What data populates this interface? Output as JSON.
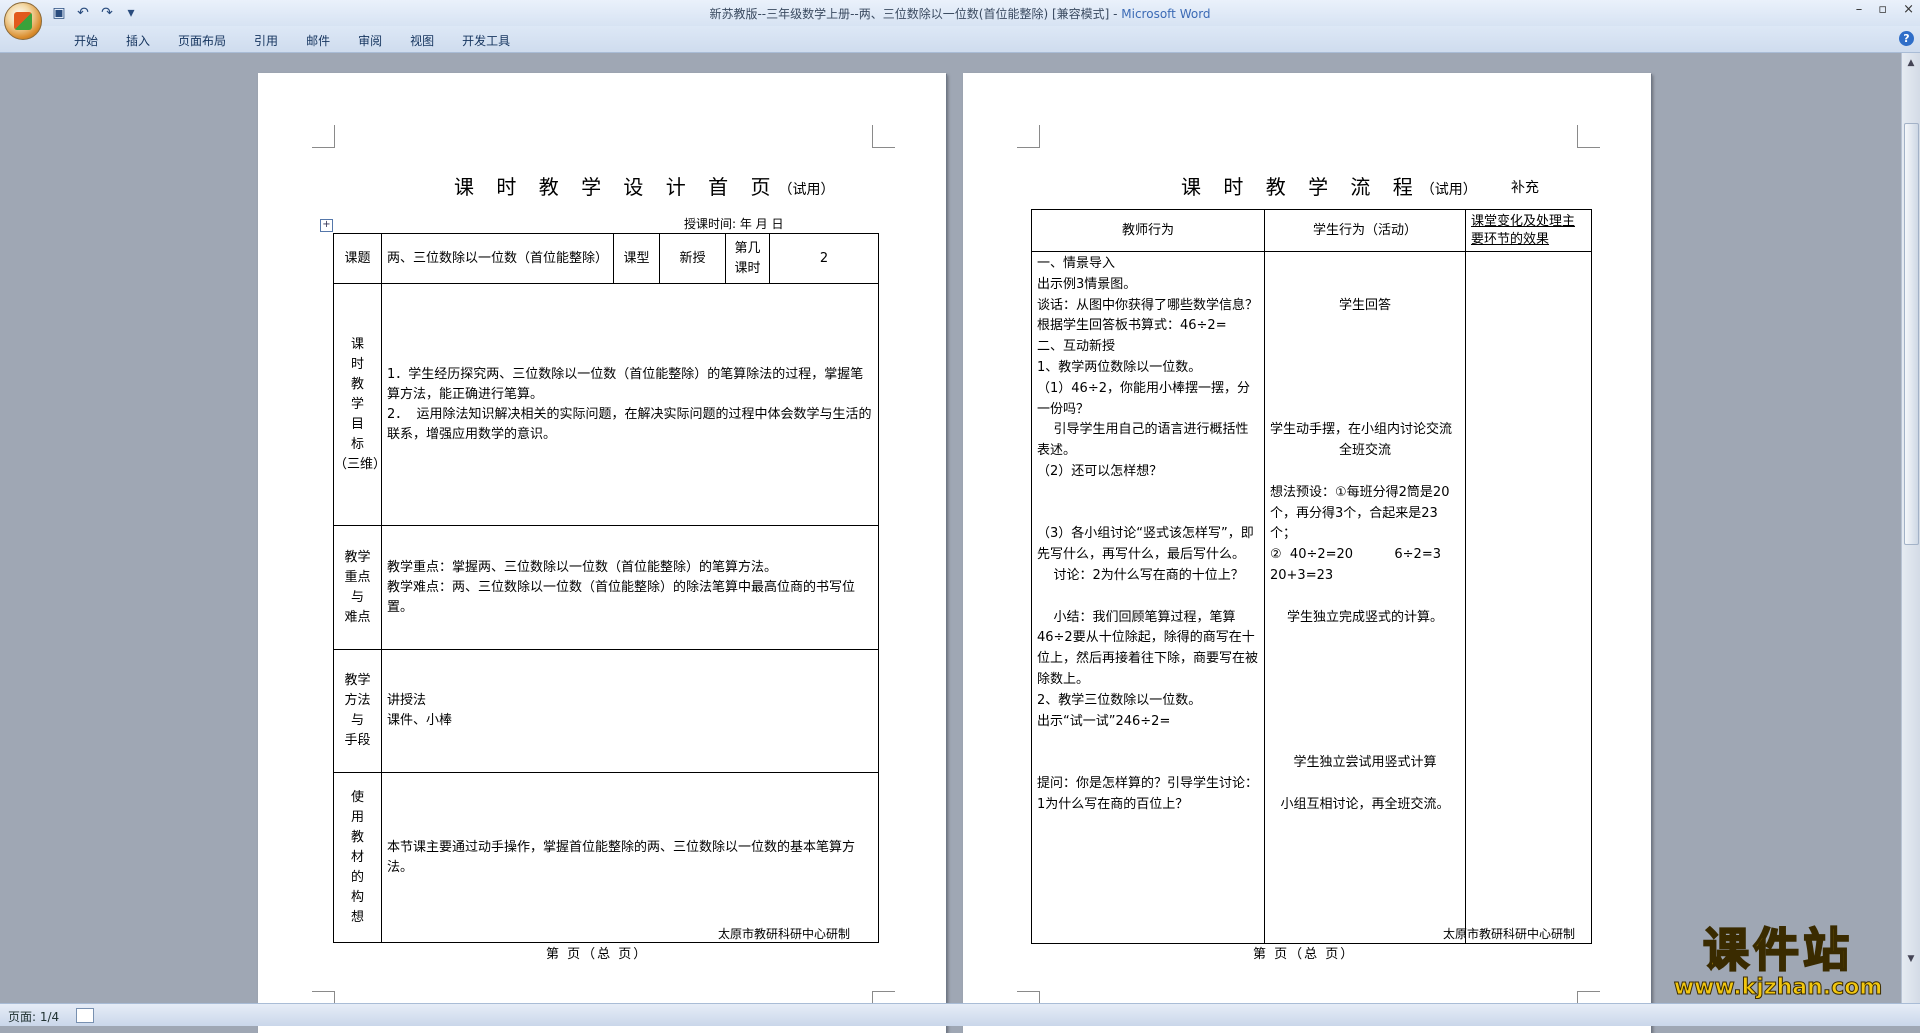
{
  "window": {
    "title": "新苏教版--三年级数学上册--两、三位数除以一位数(首位能整除) [兼容模式] - ",
    "app_name": "Microsoft Word",
    "controls": [
      "–",
      "▫",
      "×"
    ]
  },
  "ribbon": {
    "tabs": [
      "开始",
      "插入",
      "页面布局",
      "引用",
      "邮件",
      "审阅",
      "视图",
      "开发工具"
    ]
  },
  "page1": {
    "title": "课 时 教 学 设 计 首 页",
    "title_suffix": "（试用）",
    "date_line": "授课时间:      年    月    日",
    "row1": {
      "label_topic": "课题",
      "topic": "两、三位数除以一位数（首位能整除）",
      "label_type": "课型",
      "type": "新授",
      "label_period": "第几课时",
      "period": "2"
    },
    "objectives": {
      "label": [
        "课",
        "时",
        "教",
        "学",
        "目",
        "标",
        "（三维）"
      ],
      "text": "1．学生经历探究两、三位数除以一位数（首位能整除）的笔算除法的过程，掌握笔算方法，能正确进行笔算。\n2．  运用除法知识解决相关的实际问题，在解决实际问题的过程中体会数学与生活的联系，增强应用数学的意识。"
    },
    "keypoints": {
      "label": [
        "教学",
        "重点",
        "与",
        "难点"
      ],
      "text": "教学重点：掌握两、三位数除以一位数（首位能整除）的笔算方法。\n教学难点：两、三位数除以一位数（首位能整除）的除法笔算中最高位商的书写位置。"
    },
    "methods": {
      "label": [
        "教学",
        "方法",
        "与",
        "手段"
      ],
      "text": "讲授法\n课件、小棒"
    },
    "materials": {
      "label": [
        "使",
        "用",
        "教",
        "材",
        "的",
        "构",
        "想"
      ],
      "text": "本节课主要通过动手操作，掌握首位能整除的两、三位数除以一位数的基本笔算方法。"
    },
    "footer_note": "太原市教研科研中心研制",
    "page_num": "第    页（总    页）"
  },
  "page2": {
    "title": "课 时 教 学 流 程",
    "title_suffix": "（试用）",
    "supplement": "补充",
    "headers": [
      "教师行为",
      "学生行为（活动）",
      "课堂变化及处理主要环节的效果"
    ],
    "teacher_lines": [
      "一、情景导入",
      "出示例3情景图。",
      "谈话：从图中你获得了哪些数学信息？",
      "根据学生回答板书算式：46÷2=",
      "二、互动新授",
      "1、教学两位数除以一位数。",
      "（1）46÷2，你能用小棒摆一摆，分一份吗？",
      "    引导学生用自己的语言进行概括性表述。",
      "（2）还可以怎样想？",
      "",
      "",
      "（3）各小组讨论“竖式该怎样写”，即先写什么，再写什么，最后写什么。",
      "    讨论：2为什么写在商的十位上？",
      "",
      "    小结：我们回顾笔算过程，笔算46÷2要从十位除起，除得的商写在十位上，然后再接着往下除，商要写在被除数上。",
      "2、教学三位数除以一位数。",
      "出示“试一试”246÷2=",
      "",
      "",
      "提问：你是怎样算的？引导学生讨论：1为什么写在商的百位上？",
      ""
    ],
    "student_lines": [
      "",
      "",
      "学生回答",
      "",
      "",
      "",
      "",
      "",
      "学生动手摆，在小组内讨论交流",
      "全班交流",
      "",
      "想法预设：①每班分得2筒是20个，再分得3个，合起来是23个；",
      "②  40÷2=20          6÷2=3   20+3=23",
      "",
      "学生独立完成竖式的计算。",
      "",
      "",
      "",
      "",
      "",
      "",
      "学生独立尝试用竖式计算",
      "",
      "小组互相讨论，再全班交流。"
    ],
    "footer_note": "太原市教研科研中心研制",
    "page_num": "第    页（总    页）"
  },
  "status": {
    "page": "页面: 1/4"
  },
  "watermark": {
    "text": "课件站",
    "url": "www.kjzhan.com"
  }
}
